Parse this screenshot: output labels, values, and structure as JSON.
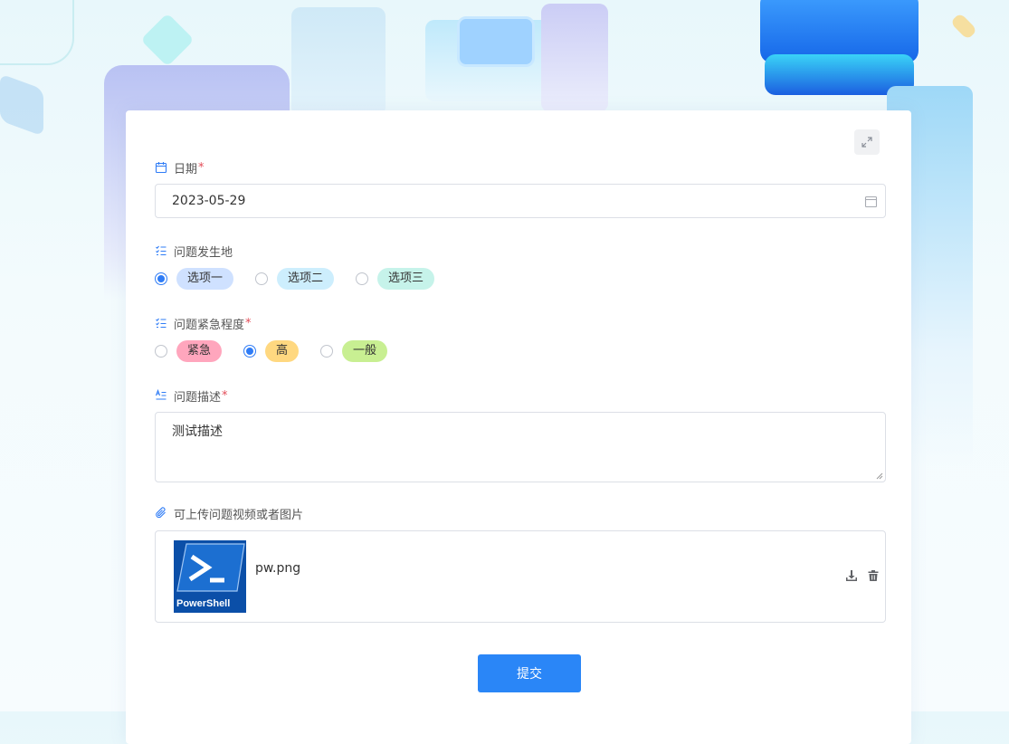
{
  "form": {
    "date": {
      "label": "日期",
      "required_mark": "*",
      "value": "2023-05-29"
    },
    "location": {
      "label": "问题发生地",
      "options": [
        {
          "label": "选项一",
          "selected": true,
          "color": "#cfe1ff"
        },
        {
          "label": "选项二",
          "selected": false,
          "color": "#cdeefd"
        },
        {
          "label": "选项三",
          "selected": false,
          "color": "#c6f3ea"
        }
      ]
    },
    "urgency": {
      "label": "问题紧急程度",
      "required_mark": "*",
      "options": [
        {
          "label": "紧急",
          "selected": false,
          "color": "#ffa6bd"
        },
        {
          "label": "高",
          "selected": true,
          "color": "#ffd880"
        },
        {
          "label": "一般",
          "selected": false,
          "color": "#c8ef92"
        }
      ]
    },
    "description": {
      "label": "问题描述",
      "required_mark": "*",
      "value": "测试描述"
    },
    "upload": {
      "label": "可上传问题视频或者图片",
      "file_name": "pw.png",
      "thumb_text": "PowerShell"
    },
    "submit_label": "提交"
  },
  "colors": {
    "accent": "#2a86f7",
    "required": "#e34d59",
    "icon_blue": "#2f7cf6"
  }
}
